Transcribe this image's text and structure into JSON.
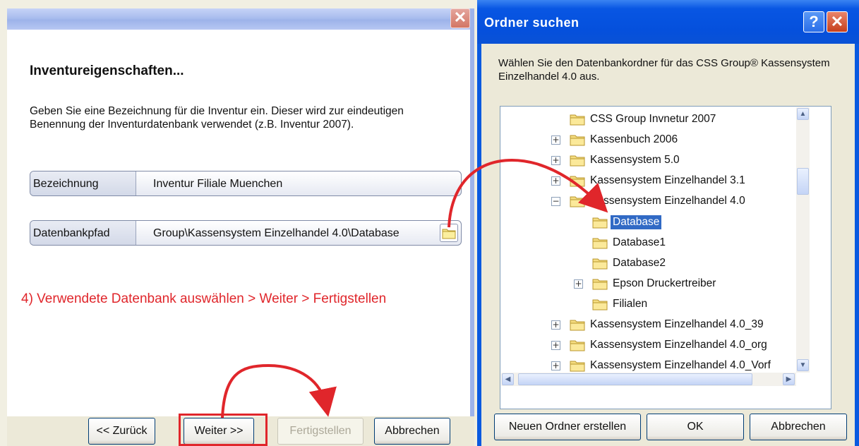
{
  "wizard": {
    "close_glyph": "✕",
    "heading": "Inventureigenschaften...",
    "description": "Geben Sie eine Bezeichnung für die Inventur ein. Dieser wird zur eindeutigen Benennung der Inventurdatenbank verwendet (z.B. Inventur 2007).",
    "fields": [
      {
        "label": "Bezeichnung",
        "value": "Inventur Filiale Muenchen"
      },
      {
        "label": "Datenbankpfad",
        "value": "Group\\Kassensystem Einzelhandel 4.0\\Database"
      }
    ],
    "instruction": "4)  Verwendete Datenbank auswählen > Weiter > Fertigstellen",
    "buttons": {
      "back": "<< Zurück",
      "next": "Weiter >>",
      "finish": "Fertigstellen",
      "cancel": "Abbrechen"
    }
  },
  "dialog": {
    "title": "Ordner suchen",
    "help_glyph": "?",
    "close_glyph": "✕",
    "description": "Wählen Sie den Datenbankordner für das CSS Group® Kassensystem Einzelhandel 4.0 aus.",
    "tree": [
      {
        "label": "CSS Group Invnetur 2007",
        "toggle": "",
        "indent": 0
      },
      {
        "label": "Kassenbuch 2006",
        "toggle": "+",
        "indent": 0
      },
      {
        "label": "Kassensystem 5.0",
        "toggle": "+",
        "indent": 0
      },
      {
        "label": "Kassensystem Einzelhandel 3.1",
        "toggle": "+",
        "indent": 0
      },
      {
        "label": "Kassensystem Einzelhandel 4.0",
        "toggle": "−",
        "indent": 0
      },
      {
        "label": "Database",
        "toggle": "",
        "indent": 1,
        "selected": true
      },
      {
        "label": "Database1",
        "toggle": "",
        "indent": 1
      },
      {
        "label": "Database2",
        "toggle": "",
        "indent": 1
      },
      {
        "label": "Epson Druckertreiber",
        "toggle": "+",
        "indent": 1
      },
      {
        "label": "Filialen",
        "toggle": "",
        "indent": 1
      },
      {
        "label": "Kassensystem Einzelhandel 4.0_39",
        "toggle": "+",
        "indent": 0
      },
      {
        "label": "Kassensystem Einzelhandel 4.0_org",
        "toggle": "+",
        "indent": 0
      },
      {
        "label": "Kassensystem Einzelhandel 4.0_Vorf",
        "toggle": "+",
        "indent": 0
      }
    ],
    "scroll_glyphs": {
      "up": "▲",
      "down": "▼",
      "left": "◀",
      "right": "▶"
    },
    "buttons": {
      "new_folder": "Neuen Ordner erstellen",
      "ok": "OK",
      "cancel": "Abbrechen"
    }
  },
  "colors": {
    "annotation_red": "#e0262b",
    "selection_blue": "#316ac5",
    "xp_title_blue": "#0550dc"
  }
}
